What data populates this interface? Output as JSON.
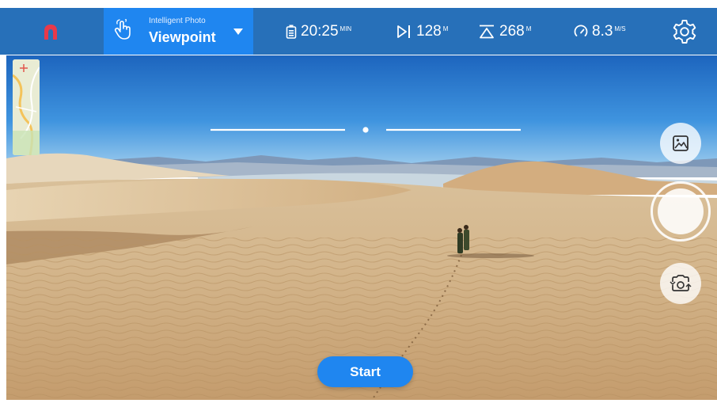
{
  "topbar": {
    "mode": {
      "sub_label": "Intelligent Photo",
      "main_label": "Viewpoint"
    },
    "flight_time": {
      "value": "20:25",
      "unit": "MIN"
    },
    "distance": {
      "value": "128",
      "unit": "M"
    },
    "altitude": {
      "value": "268",
      "unit": "M"
    },
    "speed": {
      "value": "8.3",
      "unit": "M/S"
    }
  },
  "actions": {
    "start_label": "Start"
  },
  "icons": {
    "home": "drone-home-icon",
    "mode": "hand-tap-icon",
    "caret": "caret-down-icon",
    "battery": "battery-icon",
    "distance": "distance-icon",
    "altitude": "altitude-icon",
    "speed": "speedometer-icon",
    "settings": "gear-icon",
    "gallery": "gallery-icon",
    "camera_switch": "camera-switch-icon"
  },
  "colors": {
    "topbar": "#2770b9",
    "accent": "#1f86f0",
    "home_icon": "#e8394a"
  }
}
